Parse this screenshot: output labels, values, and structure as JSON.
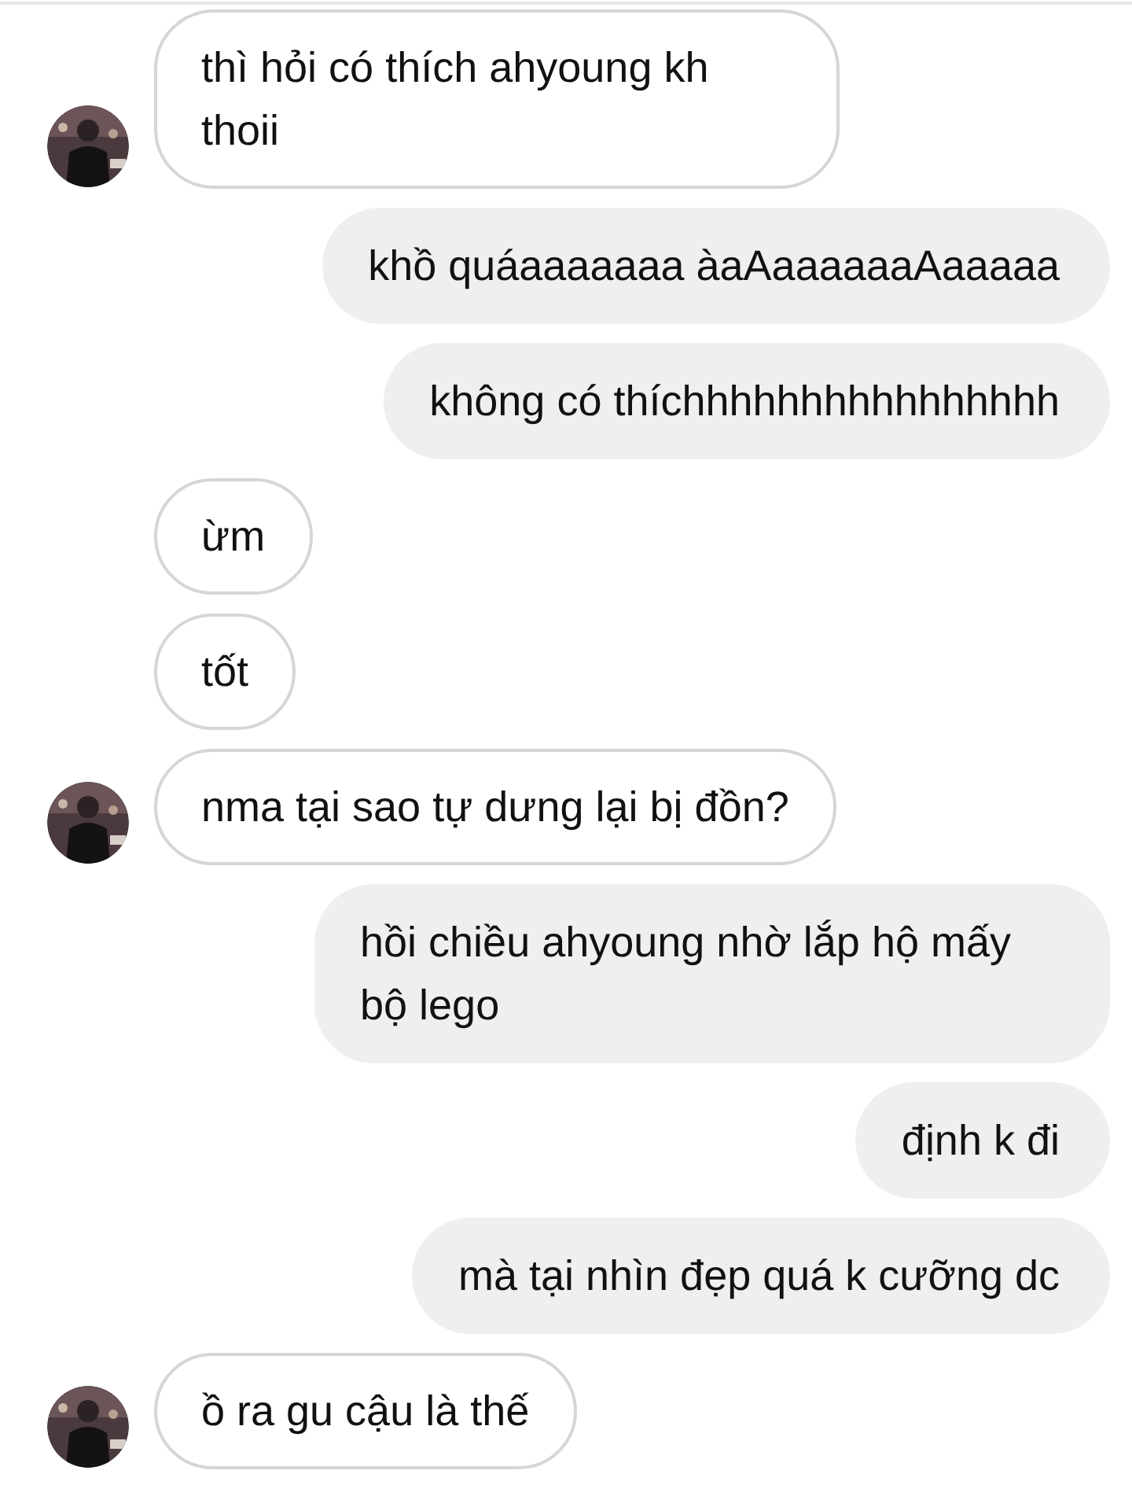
{
  "messages": [
    {
      "kind": "received",
      "avatar": true,
      "text": "thì hỏi có thích ahyoung kh thoii"
    },
    {
      "kind": "sent",
      "text": "khồ quáaaaaaaa àaAaaaaaaAaaaaa"
    },
    {
      "kind": "sent",
      "text": "không có thíchhhhhhhhhhhhhhhh"
    },
    {
      "kind": "received",
      "avatar": false,
      "text": "ừm"
    },
    {
      "kind": "received",
      "avatar": false,
      "text": "tốt"
    },
    {
      "kind": "received",
      "avatar": true,
      "text": "nma tại sao tự dưng lại bị đồn?"
    },
    {
      "kind": "sent",
      "text": "hồi chiều ahyoung nhờ lắp hộ mấy bộ lego"
    },
    {
      "kind": "sent",
      "text": "định k đi"
    },
    {
      "kind": "sent",
      "text": "mà tại nhìn đẹp quá k cưỡng dc"
    },
    {
      "kind": "received",
      "avatar": true,
      "text": "ồ ra gu cậu là thế"
    }
  ]
}
